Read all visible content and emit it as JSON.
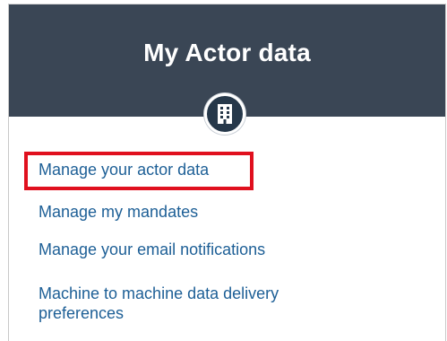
{
  "header": {
    "title": "My Actor data",
    "icon": "building-icon",
    "background_color": "#3a4655"
  },
  "links": [
    {
      "label": "Manage your actor data",
      "highlighted": true
    },
    {
      "label": "Manage my mandates"
    },
    {
      "label": "Manage your email notifications"
    },
    {
      "label": "Machine to machine data delivery preferences"
    }
  ],
  "colors": {
    "link": "#1d5f96",
    "highlight_border": "#e0101e"
  }
}
